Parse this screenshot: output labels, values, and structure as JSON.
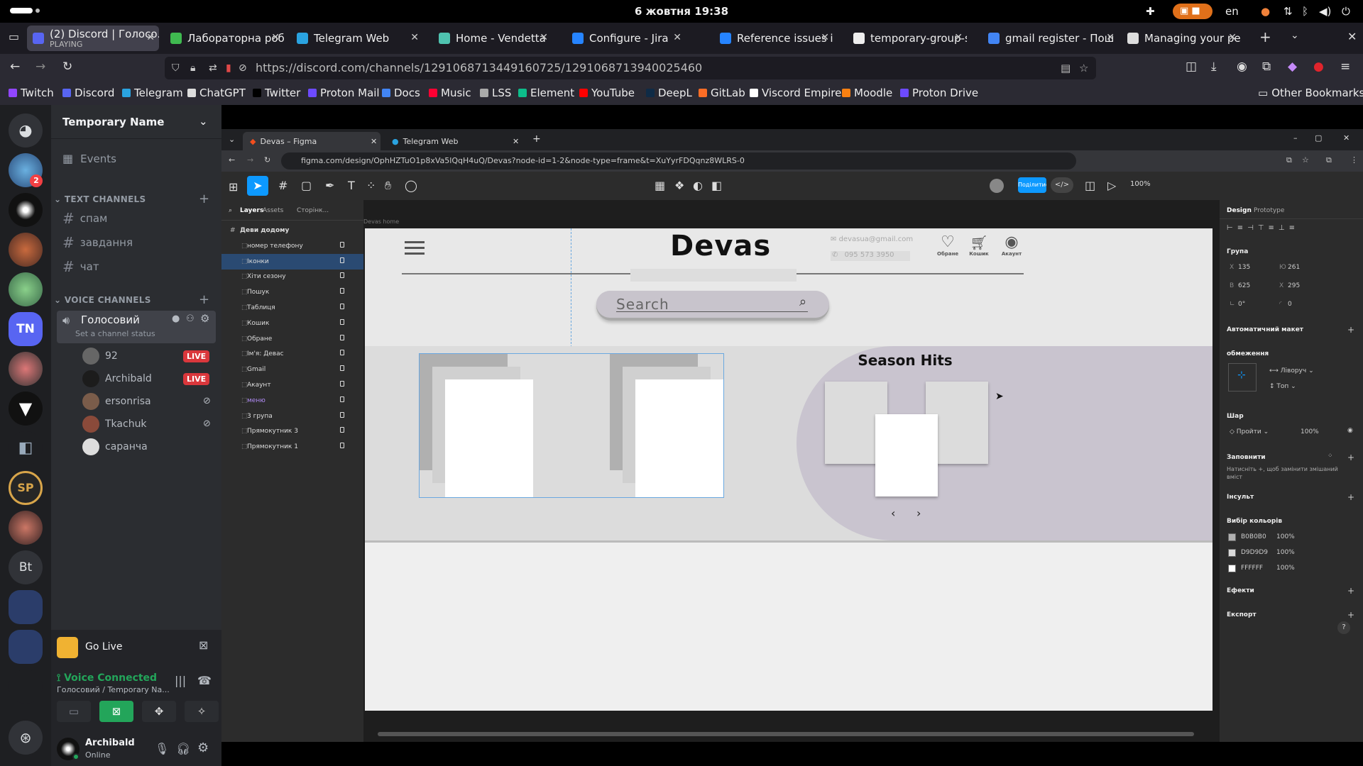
{
  "system": {
    "clock": "6 жовтня  19:38",
    "lang": "en"
  },
  "tabs": [
    {
      "title": "(2) Discord | Голосо...",
      "sub": "PLAYING",
      "color": "#5865f2"
    },
    {
      "title": "Лабораторна робот",
      "color": "#3fb950"
    },
    {
      "title": "Telegram Web",
      "color": "#2aa3e0"
    },
    {
      "title": "Home - Vendetta",
      "color": "#4fc3b0"
    },
    {
      "title": "Configure - Jira",
      "color": "#2684ff"
    },
    {
      "title": "Reference issues in y",
      "color": "#2684ff"
    },
    {
      "title": "temporary-group-si",
      "color": "#eeeeee"
    },
    {
      "title": "gmail register - Пош",
      "color": "#4285f4"
    },
    {
      "title": "Managing your pers",
      "color": "#dddddd"
    }
  ],
  "url": "https://discord.com/channels/1291068713449160725/1291068713940025460",
  "bookmarks": [
    {
      "label": "Twitch",
      "color": "#9146ff"
    },
    {
      "label": "Discord",
      "color": "#5865f2"
    },
    {
      "label": "Telegram",
      "color": "#2aa3e0"
    },
    {
      "label": "ChatGPT",
      "color": "#dddddd"
    },
    {
      "label": "Twitter",
      "color": "#000000"
    },
    {
      "label": "Proton Mail",
      "color": "#6d4aff"
    },
    {
      "label": "Docs",
      "color": "#4285f4"
    },
    {
      "label": "Music",
      "color": "#ff0033"
    },
    {
      "label": "LSS",
      "color": "#aaaaaa"
    },
    {
      "label": "Element",
      "color": "#0dbd8b"
    },
    {
      "label": "YouTube",
      "color": "#ff0000"
    },
    {
      "label": "DeepL",
      "color": "#0f2b46"
    },
    {
      "label": "GitLab",
      "color": "#fc6d26"
    },
    {
      "label": "Viscord Empire",
      "color": "#ffffff"
    },
    {
      "label": "Moodle",
      "color": "#f98012"
    },
    {
      "label": "Proton Drive",
      "color": "#6d4aff"
    }
  ],
  "other_bookmarks": "Other Bookmarks",
  "discord": {
    "server_name": "Temporary Name",
    "events": "Events",
    "text_header": "TEXT CHANNELS",
    "text_channels": [
      "спам",
      "завдання",
      "чат"
    ],
    "voice_header": "VOICE CHANNELS",
    "voice_channel": "Голосовий",
    "channel_status": "Set a channel status",
    "voice_users": [
      {
        "name": "92",
        "live": "LIVE"
      },
      {
        "name": "Archibald",
        "live": "LIVE"
      },
      {
        "name": "ersonrisa",
        "live": ""
      },
      {
        "name": "Tkachuk",
        "live": ""
      },
      {
        "name": "саранча",
        "live": ""
      }
    ],
    "server_badges": {
      "mention": "2"
    },
    "tn_label": "TN",
    "sp_label": "SP",
    "bt_label": "Bt",
    "go_live": "Go Live",
    "voice_connected": "Voice Connected",
    "voice_location": "Голосовий / Temporary Na...",
    "user_name": "Archibald",
    "user_status": "Online"
  },
  "inner_browser": {
    "tabs": [
      "Devas – Figma",
      "Telegram Web"
    ],
    "url": "figma.com/design/OphHZTuO1p8xVa5lQqH4uQ/Devas?node-id=1-2&node-type=frame&t=XuYyrFDQqnz8WLRS-0"
  },
  "figma": {
    "layer_tabs": [
      "Layers",
      "Assets",
      "Сторінк..."
    ],
    "frame_label": "Devas home",
    "layers": [
      "Деви додому",
      "номер телефону",
      "Іконки",
      "Хіти сезону",
      "Пошук",
      "Таблиця",
      "Кошик",
      "Обране",
      "Ім'я: Девас",
      "Gmail",
      "Акаунт",
      "меню",
      "3 група",
      "Прямокутник 3",
      "Прямокутник 1"
    ],
    "share_btn": "Поділитися",
    "zoom": "100%",
    "design": {
      "logo": "Devas",
      "email": "devasua@gmail.com",
      "phone": "095 573 3950",
      "nav": [
        "Обране",
        "Кошик",
        "Акаунт"
      ],
      "search_placeholder": "Search",
      "season_hits": "Season Hits"
    },
    "props": {
      "tabs": [
        "Design",
        "Prototype"
      ],
      "group": "Група",
      "x_label": "X",
      "x": "135",
      "y_label": "Ю",
      "y": "261",
      "w_label": "В",
      "w": "625",
      "h_label": "Х",
      "h": "295",
      "rotation": "0°",
      "radius": "0",
      "auto_layout": "Автоматичний макет",
      "constraints": "обмеження",
      "constraint_h": "Ліворуч",
      "constraint_v": "Топ",
      "layer": "Шар",
      "pass": "Пройти",
      "opacity": "100%",
      "fill": "Заповнити",
      "fill_hint": "Натисніть +, щоб замінити змішаний вміст",
      "stroke": "Інсульт",
      "selection_colors": "Вибір кольорів",
      "colors": [
        {
          "hex": "B0B0B0",
          "opacity": "100%",
          "swatch": "#b0b0b0"
        },
        {
          "hex": "D9D9D9",
          "opacity": "100%",
          "swatch": "#d9d9d9"
        },
        {
          "hex": "FFFFFF",
          "opacity": "100%",
          "swatch": "#ffffff"
        }
      ],
      "effects": "Ефекти",
      "export": "Експорт"
    }
  }
}
